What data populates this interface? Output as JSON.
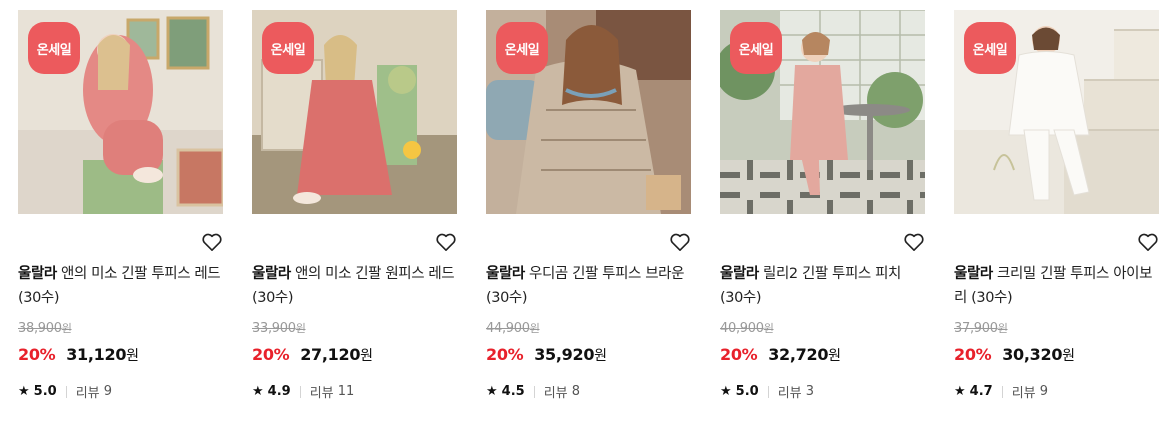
{
  "badge_label": "온세일",
  "products": [
    {
      "brand": "울랄라",
      "name": "앤의 미소 긴팔 투피스 레드 (30수)",
      "original_price": "38,900",
      "discount": "20%",
      "price": "31,120",
      "currency": "원",
      "rating": "5.0",
      "review_label": "리뷰",
      "review_count": "9",
      "palette": {
        "bg": "#d9d0c4",
        "accent": "#e07f7a",
        "floor": "#b9b0a2"
      }
    },
    {
      "brand": "울랄라",
      "name": "앤의 미소 긴팔 원피스 레드 (30수)",
      "original_price": "33,900",
      "discount": "20%",
      "price": "27,120",
      "currency": "원",
      "rating": "4.9",
      "review_label": "리뷰",
      "review_count": "11",
      "palette": {
        "bg": "#cfc4b0",
        "accent": "#d9726e",
        "floor": "#a89a83"
      }
    },
    {
      "brand": "울랄라",
      "name": "우디곰 긴팔 투피스 브라운 (30수)",
      "original_price": "44,900",
      "discount": "20%",
      "price": "35,920",
      "currency": "원",
      "rating": "4.5",
      "review_label": "리뷰",
      "review_count": "8",
      "palette": {
        "bg": "#b89c86",
        "accent": "#c9b5a0",
        "floor": "#8a9aa0"
      }
    },
    {
      "brand": "울랄라",
      "name": "릴리2 긴팔 투피스 피치 (30수)",
      "original_price": "40,900",
      "discount": "20%",
      "price": "32,720",
      "currency": "원",
      "rating": "5.0",
      "review_label": "리뷰",
      "review_count": "3",
      "palette": {
        "bg": "#c9cdbf",
        "accent": "#e2a59b",
        "floor": "#9aa38d"
      }
    },
    {
      "brand": "울랄라",
      "name": "크리밀 긴팔 투피스 아이보리 (30수)",
      "original_price": "37,900",
      "discount": "20%",
      "price": "30,320",
      "currency": "원",
      "rating": "4.7",
      "review_label": "리뷰",
      "review_count": "9",
      "palette": {
        "bg": "#ebe6dc",
        "accent": "#f7f5f1",
        "floor": "#d8cfbf"
      }
    }
  ],
  "colors": {
    "badge": "#ec5a5d",
    "discount": "#e8212b"
  },
  "icons": {
    "wishlist": "heart-outline-icon",
    "rating": "star-icon"
  }
}
